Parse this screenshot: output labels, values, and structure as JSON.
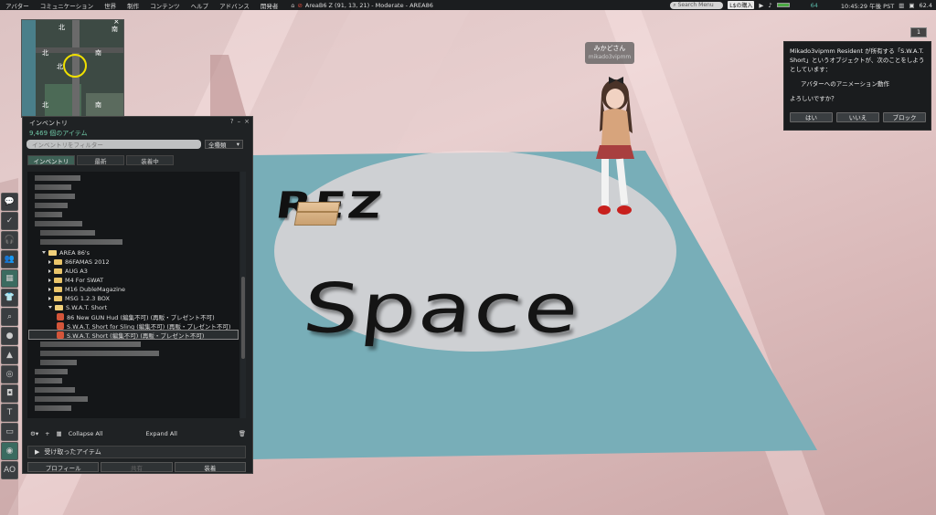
{
  "menubar": {
    "items": [
      "アバター",
      "コミュニケーション",
      "世界",
      "制作",
      "コンテンツ",
      "ヘルプ",
      "アドバンス",
      "開発者"
    ],
    "region_title": "AreaB6 Z (91, 13, 21) - Moderate - AREA86",
    "search_placeholder": "Search Menu",
    "buy_label": "L$の購入",
    "balance": "64",
    "time": "10:45:29 午後 PST",
    "fps": "62.4"
  },
  "minimap": {
    "labels": [
      "北",
      "北",
      "南",
      "南",
      "北",
      "南",
      "北"
    ]
  },
  "inventory": {
    "title": "インベントリ",
    "count": "9,469 個のアイテム",
    "filter_placeholder": "インベントリをフィルター",
    "type_select": "全種類",
    "tabs": [
      "インベントリ",
      "最新",
      "装着中"
    ],
    "area_folder": "AREA 86's",
    "folders": [
      "86FAMAS 2012",
      "AUG A3",
      "M4 For SWAT",
      "M16 DubleMagazine",
      "MSG 1.2.3 BOX"
    ],
    "swat_folder": "S.W.A.T. Short",
    "items": [
      "86 New GUN Hud (編集不可) (再販・プレゼント不可)",
      "S.W.A.T. Short for Sling (編集不可) (再販・プレゼント不可)",
      "S.W.A.T. Short (編集不可) (再販・プレゼント不可)"
    ],
    "gear_label": "⚙▾",
    "add_label": "+",
    "collapse_all": "Collapse All",
    "expand_all": "Expand All",
    "received_label": "受け取ったアイテム",
    "footer": [
      "プロフィール",
      "共有",
      "装着"
    ]
  },
  "dialog": {
    "message": "Mikado3vipmm Resident が所有する「S.W.A.T. Short」というオブジェクトが、次のことをしようとしています：",
    "action": "アバターへのアニメーション動作",
    "question": "よろしいですか？",
    "buttons": [
      "はい",
      "いいえ",
      "ブロック"
    ]
  },
  "notification_count": "1",
  "scene": {
    "rez_text": "REZ",
    "space_text": "Space",
    "avatar_name": "みかどさん",
    "avatar_username": "mikado3vipmm"
  },
  "toolbar_icons": [
    "chat-icon",
    "speak-icon",
    "voice-icon",
    "people-icon",
    "inventory-icon",
    "appearance-icon",
    "search-icon",
    "places-icon",
    "map-icon",
    "snapshot-icon",
    "camera-icon",
    "move-icon",
    "build-icon",
    "mini-map-icon",
    "ao-icon"
  ],
  "colors": {
    "accent_green": "#6fc6a5",
    "active_tab": "#3d6055",
    "floor_blue": "#78aeb8"
  }
}
